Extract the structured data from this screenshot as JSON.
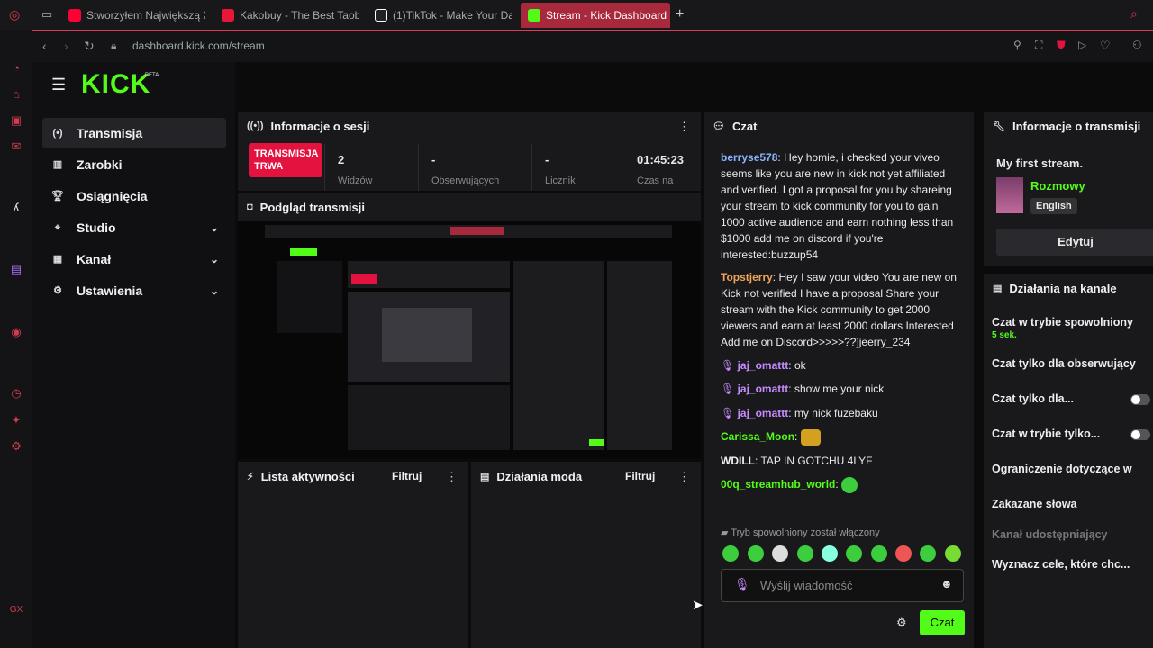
{
  "browser": {
    "tabs": [
      {
        "title": "Stworzyłem Największą 2",
        "icon_color": "#ff0033"
      },
      {
        "title": "Kakobuy - The Best Taob",
        "icon_color": "#e8173a"
      },
      {
        "title": "(1)TikTok - Make Your Da",
        "icon_color": "#ffffff"
      },
      {
        "title": "Stream - Kick Dashboard",
        "icon_color": "#53fc18"
      }
    ],
    "url": "dashboard.kick.com/stream"
  },
  "brand": {
    "logo": "KICK",
    "beta": "BETA",
    "accent": "#53fc18"
  },
  "sidebar": {
    "items": [
      {
        "label": "Transmisja",
        "icon": "live-icon"
      },
      {
        "label": "Zarobki",
        "icon": "chart-icon"
      },
      {
        "label": "Osiągnięcia",
        "icon": "trophy-icon"
      },
      {
        "label": "Studio",
        "icon": "studio-icon",
        "expandable": true
      },
      {
        "label": "Kanał",
        "icon": "channel-icon",
        "expandable": true
      },
      {
        "label": "Ustawienia",
        "icon": "gear-icon",
        "expandable": true
      }
    ]
  },
  "session": {
    "title": "Informacje o sesji",
    "live_badge": "TRANSMISJA TRWA",
    "stats": [
      {
        "value": "2",
        "label": "Widzów"
      },
      {
        "value": "-",
        "label": "Obserwujących"
      },
      {
        "value": "-",
        "label": "Licznik"
      },
      {
        "value": "01:45:23",
        "label": "Czas na"
      }
    ]
  },
  "preview": {
    "title": "Podgląd transmisji"
  },
  "activity": {
    "title": "Lista aktywności",
    "filter": "Filtruj"
  },
  "modactions": {
    "title": "Działania moda",
    "filter": "Filtruj"
  },
  "chat": {
    "title": "Czat",
    "messages": [
      {
        "user": "berryse578",
        "color": "#8ab4ff",
        "text": "Hey homie, i checked your viveo seems like you are new in kick not yet affiliated and verified. I got a proposal for you by shareing your stream to kick community for you to gain 1000 active audience and earn nothing less than $1000 add me on discord if you're interested:buzzup54"
      },
      {
        "user": "Topstjerry",
        "color": "#f0a35a",
        "text": "Hey I saw your video You are new on Kick not verified I have a proposal Share your stream with the Kick community to get 2000 viewers and earn at least 2000 dollars Interested Add me on Discord>>>>>??]jeerry_234"
      },
      {
        "user": "jaj_omattt",
        "color": "#c58bff",
        "text": "ok"
      },
      {
        "user": "jaj_omattt",
        "color": "#c58bff",
        "text": "show me your nick"
      },
      {
        "user": "jaj_omattt",
        "color": "#c58bff",
        "text": "my nick fuzebaku"
      },
      {
        "user": "Carissa_Moon",
        "color": "#53fc18",
        "text": ""
      },
      {
        "user": "WDILL",
        "color": "#f1f1f1",
        "text": "TAP IN GOTCHU 4LYF"
      },
      {
        "user": "00q_streamhub_world",
        "color": "#53fc18",
        "text": ""
      }
    ],
    "slow_mode_notice": "Tryb spowolniony został włączony",
    "placeholder": "Wyślij wiadomość",
    "send": "Czat"
  },
  "stream_info": {
    "title": "Informacje o transmisji",
    "stream_title": "My first stream.",
    "category": "Rozmowy",
    "language": "English",
    "edit": "Edytuj"
  },
  "channel_actions": {
    "title": "Działania na kanale",
    "items": [
      {
        "label": "Czat w trybie spowolniony",
        "sub": "5 sek."
      },
      {
        "label": "Czat tylko dla obserwujący"
      },
      {
        "label": "Czat tylko dla...",
        "toggle": true
      },
      {
        "label": "Czat w trybie tylko...",
        "toggle": true
      },
      {
        "label": "Ograniczenie dotyczące w"
      },
      {
        "label": "Zakazane słowa"
      },
      {
        "label": "Kanał udostępniający",
        "muted": true
      },
      {
        "label": "Wyznacz cele, które chc..."
      }
    ]
  }
}
